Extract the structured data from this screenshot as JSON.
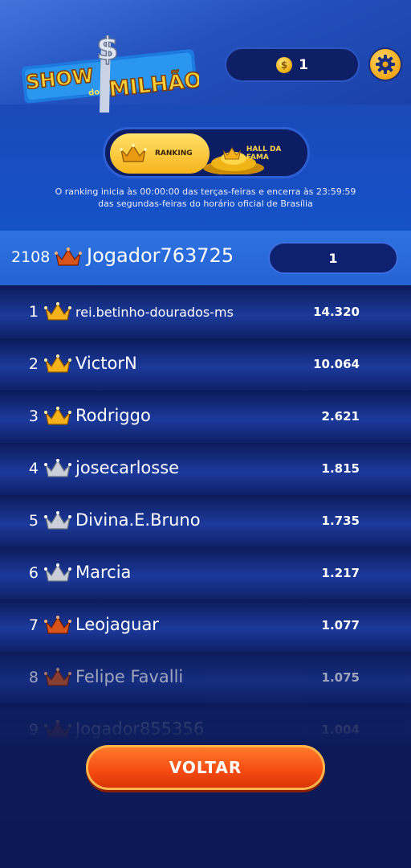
{
  "header": {
    "logo_text_top": "SHOW",
    "logo_text_mid": "do",
    "logo_text_bottom": "MILHÃO",
    "coins": "1",
    "coin_symbol": "$"
  },
  "tabs": {
    "ranking": "RANKING",
    "hall": "HALL DA FAMA"
  },
  "info": "O ranking inicia às 00:00:00 das terças-feiras e encerra às 23:59:59 das segundas-feiras do horário oficial de Brasília",
  "player": {
    "rank": "2108",
    "name": "Jogador763725",
    "score": "1"
  },
  "ranking": [
    {
      "rank": "1",
      "name": "rei.betinho-dourados-ms",
      "score": "14.320",
      "crown": "gold"
    },
    {
      "rank": "2",
      "name": "VictorN",
      "score": "10.064",
      "crown": "gold"
    },
    {
      "rank": "3",
      "name": "Rodriggo",
      "score": "2.621",
      "crown": "gold"
    },
    {
      "rank": "4",
      "name": "josecarlosse",
      "score": "1.815",
      "crown": "silver"
    },
    {
      "rank": "5",
      "name": "Divina.E.Bruno",
      "score": "1.735",
      "crown": "silver"
    },
    {
      "rank": "6",
      "name": "Marcia",
      "score": "1.217",
      "crown": "silver"
    },
    {
      "rank": "7",
      "name": "Leojaguar",
      "score": "1.077",
      "crown": "bronze"
    },
    {
      "rank": "8",
      "name": "Felipe Favalli",
      "score": "1.075",
      "crown": "bronze"
    },
    {
      "rank": "9",
      "name": "Jogador855356",
      "score": "1.004",
      "crown": "bronze"
    }
  ],
  "back_button": "VOLTAR",
  "colors": {
    "gold_crown": "#f5b21a",
    "silver_crown": "#c9ced8",
    "bronze_crown": "#d9541a",
    "accent_orange": "#f54a12"
  }
}
